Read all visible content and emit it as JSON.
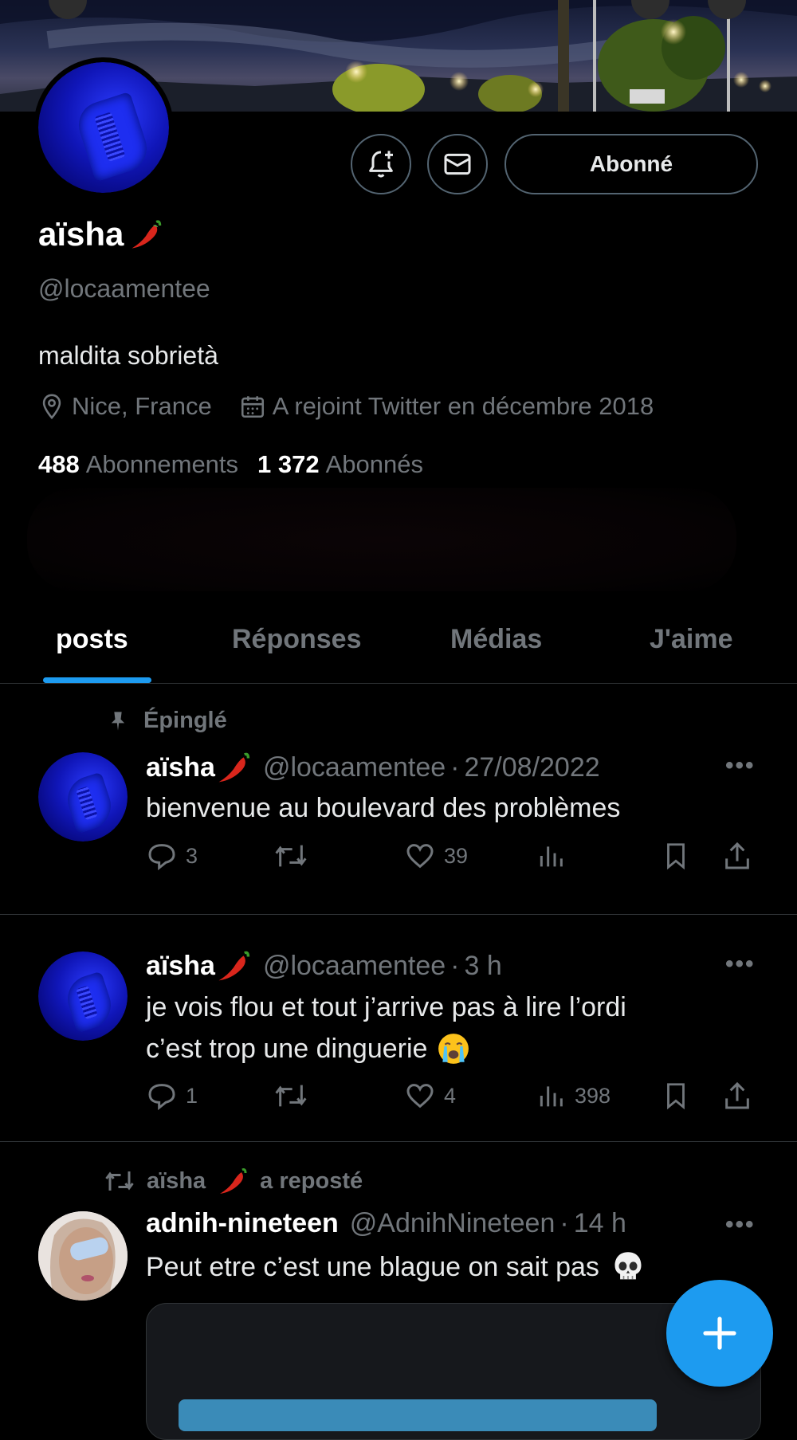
{
  "profile": {
    "name": "aïsha",
    "handle": "@locaamentee",
    "bio": "maldita sobrietà",
    "location": "Nice, France",
    "joined": "A rejoint Twitter en décembre 2018",
    "following_count": "488",
    "following_label": "Abonnements",
    "followers_count": "1 372",
    "followers_label": "Abonnés",
    "follow_button": "Abonné"
  },
  "tabs": [
    {
      "label": "posts",
      "active": true
    },
    {
      "label": "Réponses",
      "active": false
    },
    {
      "label": "Médias",
      "active": false
    },
    {
      "label": "J'aime",
      "active": false
    }
  ],
  "tweets": [
    {
      "pinned_label": "Épinglé",
      "name": "aïsha",
      "handle": "@locaamentee",
      "separator": "·",
      "time": "27/08/2022",
      "text": "bienvenue au boulevard des problèmes",
      "replies": "3",
      "likes": "39",
      "views": ""
    },
    {
      "name": "aïsha",
      "handle": "@locaamentee",
      "separator": "·",
      "time": "3 h",
      "text_line1": "je vois flou et tout j’arrive pas à lire l’ordi",
      "text_line2": "c’est trop une dinguerie",
      "replies": "1",
      "likes": "4",
      "views": "398"
    },
    {
      "repost_by": "aïsha",
      "repost_label": "a reposté",
      "name": "adnih-nineteen",
      "handle": "@AdnihNineteen",
      "separator": "·",
      "time": "14 h",
      "text": "Peut etre c’est une blague on sait pas"
    }
  ],
  "more_label": "•••",
  "colors": {
    "accent": "#1d9bf0",
    "muted": "#71767b",
    "border": "#2f3336",
    "background": "#000000"
  },
  "icons": [
    "notification-bell-plus-icon",
    "mail-icon",
    "location-pin-icon",
    "calendar-icon",
    "pin-icon",
    "reply-icon",
    "repost-icon",
    "like-icon",
    "views-icon",
    "bookmark-icon",
    "share-icon",
    "compose-plus-icon",
    "chili-emoji",
    "loudly-crying-emoji",
    "skull-emoji"
  ]
}
